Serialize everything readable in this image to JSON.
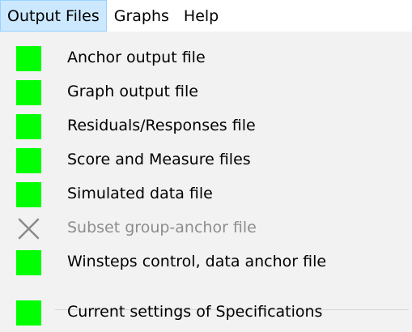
{
  "menubar": {
    "items": [
      {
        "label": "Output Files"
      },
      {
        "label": "Graphs"
      },
      {
        "label": "Help"
      }
    ]
  },
  "dropdown": {
    "items": [
      {
        "label": "Anchor output file",
        "enabled": true
      },
      {
        "label": "Graph output file",
        "enabled": true
      },
      {
        "label": "Residuals/Responses file",
        "enabled": true
      },
      {
        "label": "Score and Measure files",
        "enabled": true
      },
      {
        "label": "Simulated data file",
        "enabled": true
      },
      {
        "label": "Subset group-anchor file",
        "enabled": false
      },
      {
        "label": "Winsteps control, data  anchor file",
        "enabled": true
      },
      {
        "label": "Current settings of Specifications",
        "enabled": true
      }
    ]
  },
  "colors": {
    "indicator_on": "#00ff00",
    "menubar_active": "#cce8ff",
    "menu_bg": "#f2f2f2",
    "disabled_text": "#8d8d8d"
  },
  "icons": {
    "enabled": "green-square-icon",
    "disabled": "gray-x-icon"
  }
}
